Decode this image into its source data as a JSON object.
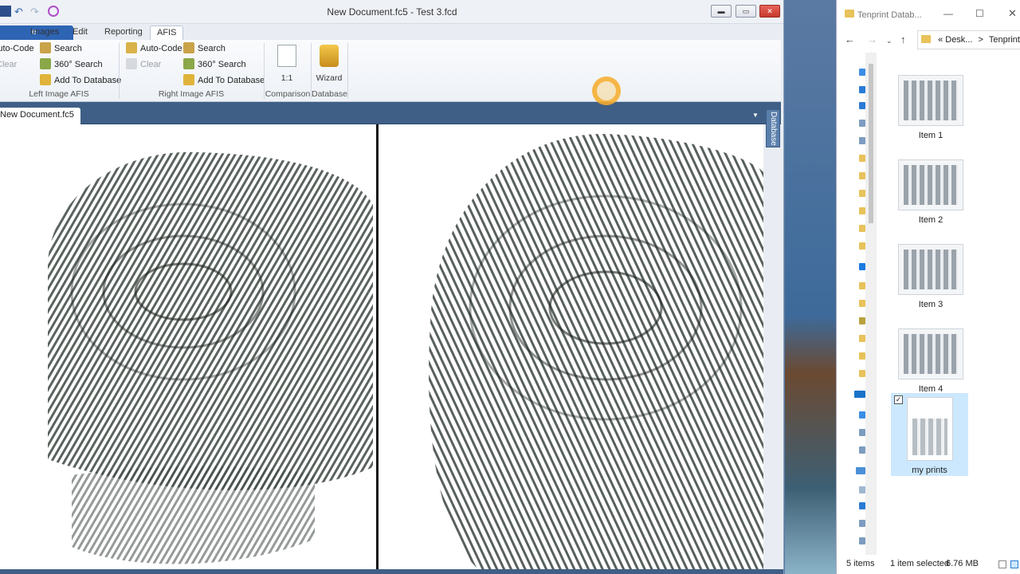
{
  "app": {
    "title": "New Document.fc5 - Test 3.fcd",
    "tabs": [
      {
        "label": "e"
      },
      {
        "label": "Images"
      },
      {
        "label": "Edit"
      },
      {
        "label": "Reporting"
      },
      {
        "label": "AFIS"
      }
    ],
    "ribbon": {
      "left_group": {
        "label": "Left Image AFIS",
        "auto_code": "Auto-Code",
        "clear": "Clear",
        "search": "Search",
        "search360": "360° Search",
        "add_db": "Add To Database"
      },
      "right_group": {
        "label": "Right Image AFIS",
        "auto_code": "Auto-Code",
        "clear": "Clear",
        "search": "Search",
        "search360": "360° Search",
        "add_db": "Add To Database"
      },
      "comparison": {
        "label": "Comparison",
        "button": "1:1"
      },
      "database": {
        "label": "Database",
        "button": "Wizard"
      }
    },
    "document_tab": "New Document.fc5",
    "side_tab": "Database"
  },
  "explorer": {
    "title": "Tenprint Datab...",
    "breadcrumb": [
      "«",
      "Desk...",
      ">",
      "Tenprint"
    ],
    "items": [
      {
        "label": "Item 1",
        "selected": false
      },
      {
        "label": "Item 2",
        "selected": false
      },
      {
        "label": "Item 3",
        "selected": false
      },
      {
        "label": "Item 4",
        "selected": false
      },
      {
        "label": "my prints",
        "selected": true
      }
    ],
    "status": {
      "count": "5 items",
      "selection": "1 item selected",
      "size": "6.76 MB"
    }
  },
  "colors": {
    "accent": "#2e64b4",
    "doc_bar": "#3f5f86",
    "selection": "#cce8ff"
  }
}
